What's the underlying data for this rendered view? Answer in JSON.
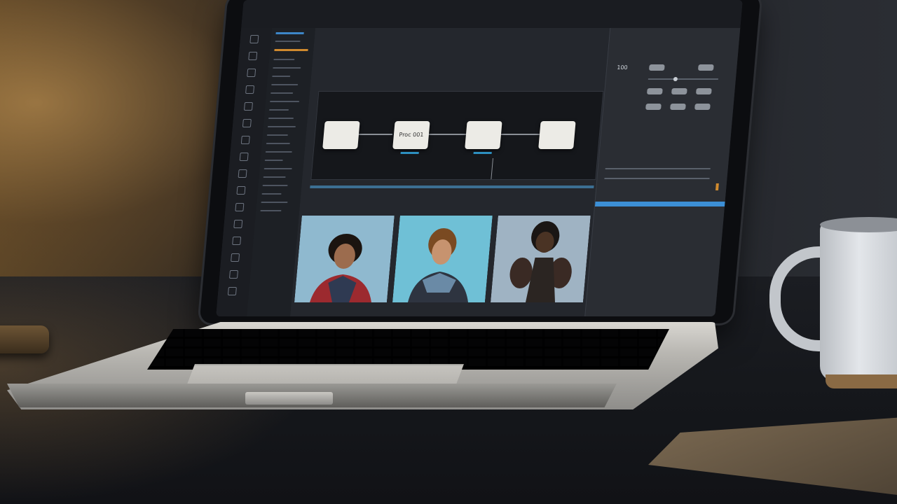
{
  "scene": {
    "description_colors": {
      "wall_warm": "#5a4426",
      "desk": "#15171b",
      "accent_orange": "#d08a2e",
      "accent_blue": "#3c8fd6"
    }
  },
  "app": {
    "graph": {
      "nodes": [
        {
          "label": ""
        },
        {
          "label": "Proc 001"
        },
        {
          "label": ""
        },
        {
          "label": ""
        }
      ]
    },
    "thumbnails": [
      {
        "icon": "portrait-curly-hair"
      },
      {
        "icon": "portrait-brown-hair"
      },
      {
        "icon": "portrait-dark-figure"
      }
    ],
    "right_panel": {
      "value_main": "100"
    }
  }
}
